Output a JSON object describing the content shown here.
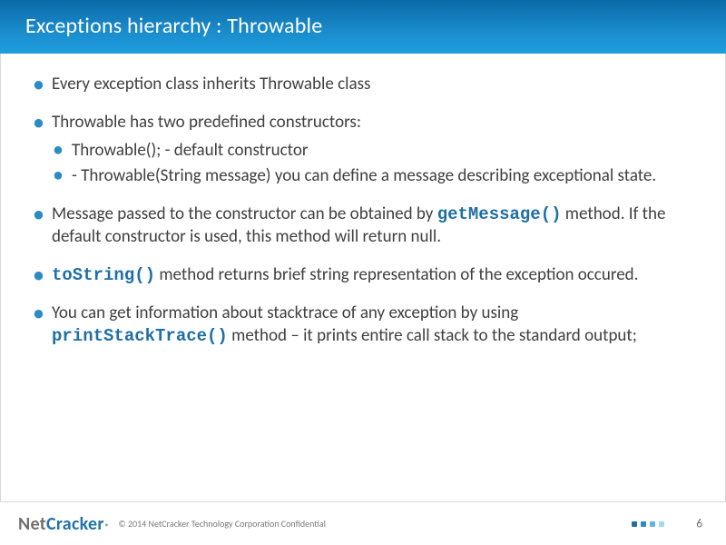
{
  "title": "Exceptions hierarchy : Throwable",
  "bullets": {
    "b1": "Every exception class inherits Throwable class",
    "b2": "Throwable has two predefined constructors:",
    "b2a": "Throwable(); - default constructor",
    "b2b": "- Throwable(String message) you can define a message describing exceptional state.",
    "b3_pre": "Message passed to the constructor can be obtained by ",
    "b3_code": "getMessage()",
    "b3_post": " method. If the default constructor is used, this method will return null.",
    "b4_code": "toString()",
    "b4_post": " method returns brief string representation of the exception occured.",
    "b5_pre": "You can get information about stacktrace of any exception by using ",
    "b5_code": "printStackTrace()",
    "b5_post": " method – it prints entire call stack to the standard output;"
  },
  "footer": {
    "logo_net": "Net",
    "logo_cracker": "Cracker",
    "reg": "®",
    "copyright": "© 2014 NetCracker Technology Corporation Confidential",
    "page": "6"
  }
}
